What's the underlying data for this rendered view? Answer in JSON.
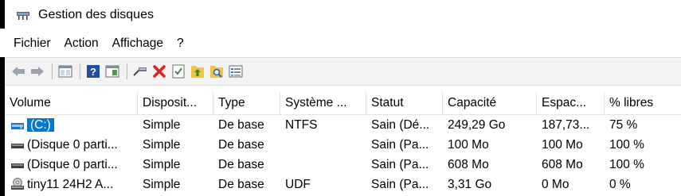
{
  "window": {
    "title": "Gestion des disques",
    "icon": "disk-management-icon"
  },
  "menu": [
    {
      "label": "Fichier"
    },
    {
      "label": "Action"
    },
    {
      "label": "Affichage"
    },
    {
      "label": "?"
    }
  ],
  "toolbar": {
    "buttons": [
      "back-arrow-icon",
      "forward-arrow-icon",
      "list-view-icon",
      "help-icon",
      "properties-view-icon",
      "connect-disk-icon",
      "delete-x-icon",
      "checkmark-doc-icon",
      "folder-up-icon",
      "search-folder-icon",
      "details-icon"
    ],
    "colors": {
      "delete": "#e02020",
      "help": "#1f4ea3"
    }
  },
  "table": {
    "headers": [
      "Volume",
      "Disposit...",
      "Type",
      "Système ...",
      "Statut",
      "Capacité",
      "Espac...",
      "% libres"
    ],
    "rows": [
      {
        "volume": "(C:)",
        "disposition": "Simple",
        "type": "De base",
        "fs": "NTFS",
        "status": "Sain (Dé...",
        "capacity": "249,29 Go",
        "free": "187,73...",
        "pct": "75 %",
        "selected": true,
        "icon": "drive-blue-icon"
      },
      {
        "volume": "(Disque 0 parti...",
        "disposition": "Simple",
        "type": "De base",
        "fs": "",
        "status": "Sain (Pa...",
        "capacity": "100 Mo",
        "free": "100 Mo",
        "pct": "100 %",
        "icon": "drive-dark-icon"
      },
      {
        "volume": "(Disque 0 parti...",
        "disposition": "Simple",
        "type": "De base",
        "fs": "",
        "status": "Sain (Pa...",
        "capacity": "608 Mo",
        "free": "608 Mo",
        "pct": "100 %",
        "icon": "drive-dark-icon"
      },
      {
        "volume": "tiny11 24H2 A...",
        "disposition": "Simple",
        "type": "De base",
        "fs": "UDF",
        "status": "Sain (Pa...",
        "capacity": "3,31 Go",
        "free": "0 Mo",
        "pct": "0 %",
        "icon": "cd-drive-icon"
      }
    ]
  },
  "colors": {
    "selection": "#0078d7",
    "toolbar_bg": "#f3f3f3"
  }
}
